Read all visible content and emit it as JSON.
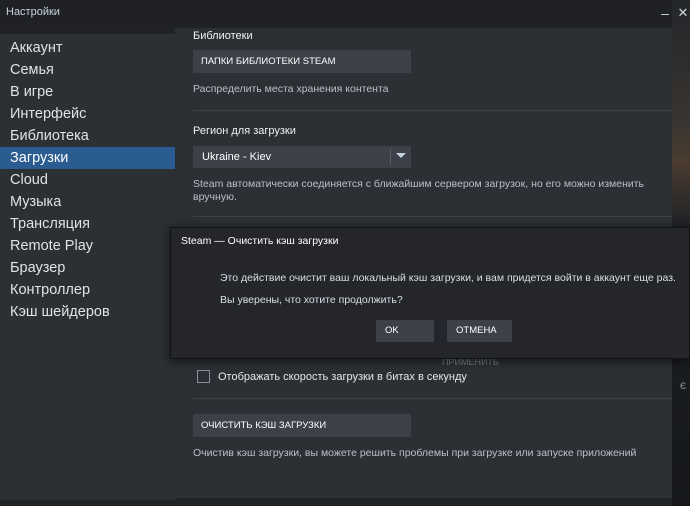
{
  "window": {
    "title": "Настройки"
  },
  "sidebar": {
    "items": [
      {
        "label": "Аккаунт"
      },
      {
        "label": "Семья"
      },
      {
        "label": "В игре"
      },
      {
        "label": "Интерфейс"
      },
      {
        "label": "Библиотека"
      },
      {
        "label": "Загрузки",
        "active": true
      },
      {
        "label": "Cloud"
      },
      {
        "label": "Музыка"
      },
      {
        "label": "Трансляция"
      },
      {
        "label": "Remote Play"
      },
      {
        "label": "Браузер"
      },
      {
        "label": "Контроллер"
      },
      {
        "label": "Кэш шейдеров"
      }
    ]
  },
  "main": {
    "libraries": {
      "heading": "Библиотеки",
      "button": "ПАПКИ БИБЛИОТЕКИ STEAM",
      "description": "Распределить места хранения контента"
    },
    "region": {
      "heading": "Регион для загрузки",
      "selected": "Ukraine - Kiev",
      "description_line1": "Steam автоматически соединяется с ближайшим сервером загрузок, но его можно изменить",
      "description_line2": "вручную."
    },
    "apply_label": "ПРИМЕНИТЬ",
    "bits_checkbox": {
      "label": "Отображать скорость загрузки в битах в секунду",
      "checked": false
    },
    "cache": {
      "button": "ОЧИСТИТЬ КЭШ ЗАГРУЗКИ",
      "description": "Очистив кэш загрузки, вы можете решить проблемы при загрузке или запуске приложений"
    }
  },
  "dialog": {
    "title": "Steam — Очистить кэш загрузки",
    "message": "Это действие очистит ваш локальный кэш загрузки, и вам придется войти в аккаунт еще раз.",
    "question": "Вы уверены, что хотите продолжить?",
    "ok_label": "OK",
    "cancel_label": "ОТМЕНА"
  },
  "colors": {
    "accent_selected": "#2b5c91",
    "button_bg": "#3d4048",
    "content_bg": "#2c2f34"
  }
}
